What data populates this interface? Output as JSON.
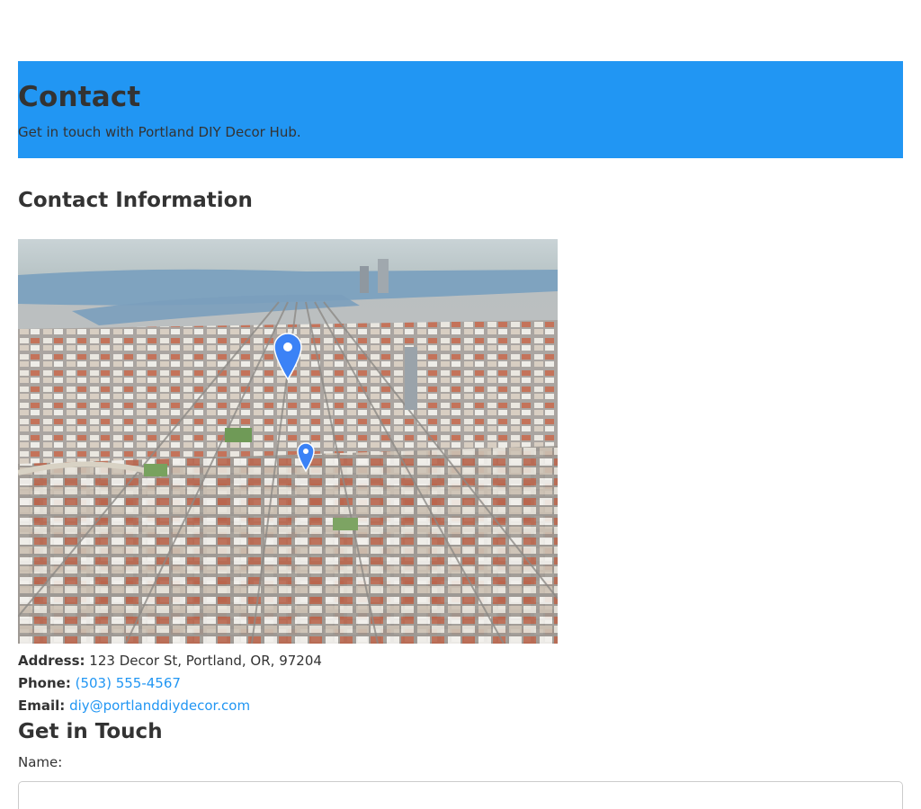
{
  "hero": {
    "title": "Contact",
    "subtitle": "Get in touch with Portland DIY Decor Hub."
  },
  "contact_info": {
    "heading": "Contact Information",
    "address_label": "Address:",
    "address_value": "123 Decor St, Portland, OR, 97204",
    "phone_label": "Phone:",
    "phone_value": "(503) 555-4567",
    "email_label": "Email:",
    "email_value": "diy@portlanddiydecor.com"
  },
  "form": {
    "heading": "Get in Touch",
    "name_label": "Name:",
    "name_value": "",
    "name_placeholder": ""
  },
  "colors": {
    "accent": "#2196f3",
    "text": "#333333",
    "map_pin": "#3b82f6"
  },
  "icons": [
    "map-pin-icon"
  ]
}
